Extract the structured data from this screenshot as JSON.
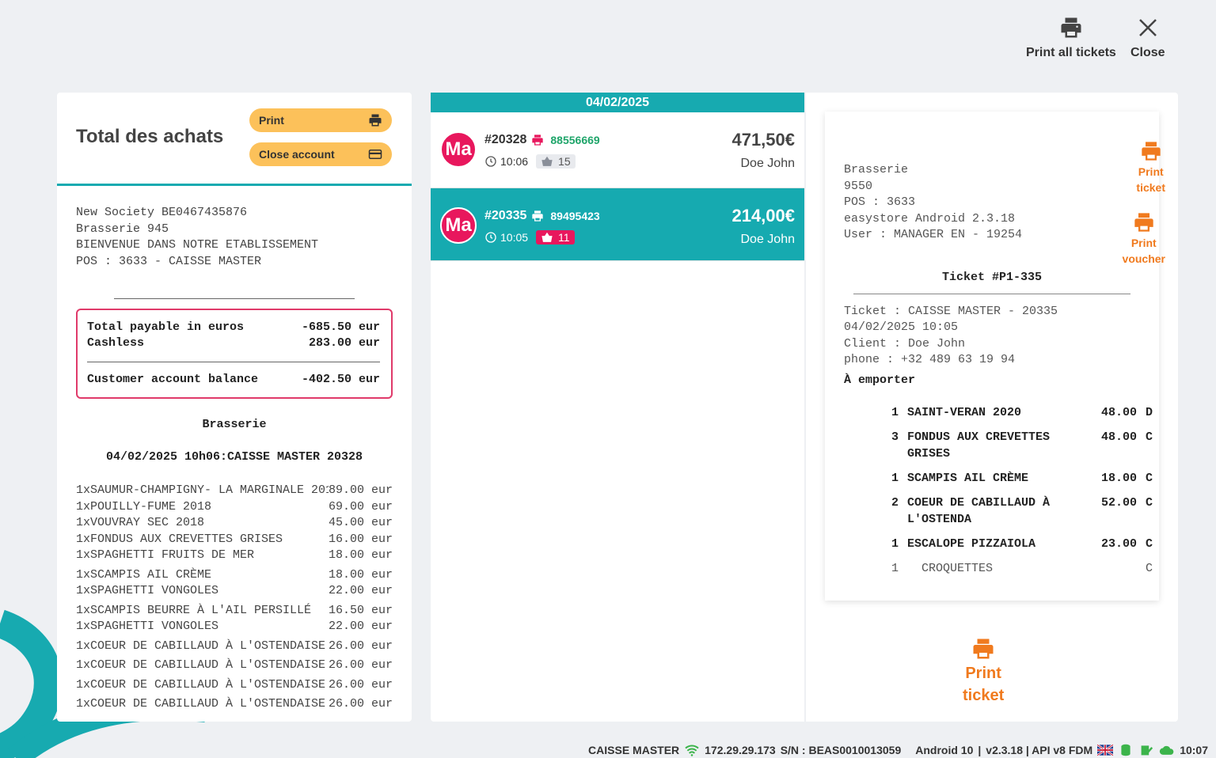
{
  "top_actions": {
    "print_all": "Print all tickets",
    "close": "Close"
  },
  "left": {
    "title": "Total des achats",
    "print_btn": "Print",
    "close_account_btn": "Close account",
    "society": [
      "New Society BE0467435876",
      "Brasserie 945",
      "BIENVENUE DANS NOTRE ETABLISSEMENT",
      "POS : 3633 - CAISSE MASTER"
    ],
    "totals": {
      "payable_label": "Total payable in euros",
      "payable_value": "-685.50 eur",
      "cashless_label": "Cashless",
      "cashless_value": "283.00 eur",
      "balance_label": "Customer account balance",
      "balance_value": "-402.50 eur"
    },
    "venue": "Brasserie",
    "header_line": "04/02/2025 10h06:CAISSE MASTER 20328",
    "items": [
      {
        "name": "1xSAUMUR-CHAMPIGNY- LA MARGINALE 2019",
        "price": "89.00 eur"
      },
      {
        "name": "1xPOUILLY-FUME 2018",
        "price": "69.00 eur"
      },
      {
        "name": "1xVOUVRAY SEC 2018",
        "price": "45.00 eur"
      },
      {
        "name": "1xFONDUS AUX CREVETTES GRISES",
        "price": "16.00 eur"
      },
      {
        "name": "1xSPAGHETTI FRUITS DE MER",
        "price": "18.00 eur"
      },
      {
        "name": "1xSCAMPIS AIL CRÈME",
        "price": "18.00 eur"
      },
      {
        "name": "1xSPAGHETTI VONGOLES",
        "price": "22.00 eur"
      },
      {
        "name": "1xSCAMPIS BEURRE À L'AIL PERSILLÉ",
        "price": "16.50 eur"
      },
      {
        "name": "1xSPAGHETTI VONGOLES",
        "price": "22.00 eur"
      },
      {
        "name": "1xCOEUR DE CABILLAUD À L'OSTENDAISE",
        "price": "26.00 eur"
      },
      {
        "name": "1xCOEUR DE CABILLAUD À L'OSTENDAISE",
        "price": "26.00 eur"
      },
      {
        "name": "1xCOEUR DE CABILLAUD À L'OSTENDAISE",
        "price": "26.00 eur"
      },
      {
        "name": "1xCOEUR DE CABILLAUD À L'OSTENDAISE",
        "price": "26.00 eur"
      }
    ]
  },
  "middle": {
    "date": "04/02/2025",
    "tickets": [
      {
        "initials": "Ma",
        "number": "#20328",
        "code": "88556669",
        "time": "10:06",
        "count": "15",
        "amount": "471,50€",
        "customer": "Doe John"
      },
      {
        "initials": "Ma",
        "number": "#20335",
        "code": "89495423",
        "time": "10:05",
        "count": "11",
        "amount": "214,00€",
        "customer": "Doe John"
      }
    ]
  },
  "right": {
    "print_ticket": [
      "Print",
      "ticket"
    ],
    "print_voucher": [
      "Print",
      "voucher"
    ],
    "receipt_header": [
      "Brasserie",
      "9550",
      "POS : 3633",
      "easystore Android 2.3.18",
      "User : MANAGER EN - 19254"
    ],
    "receipt_title": "Ticket #P1-335",
    "receipt_info": [
      "Ticket : CAISSE MASTER - 20335",
      "04/02/2025 10:05",
      "Client : Doe John",
      "phone : +32 489 63 19 94"
    ],
    "takeaway": "À emporter",
    "items": [
      {
        "qty": "1",
        "name": "SAINT-VERAN  2020",
        "price": "48.00",
        "code": "D"
      },
      {
        "qty": "3",
        "name": "FONDUS AUX CREVETTES GRISES",
        "price": "48.00",
        "code": "C"
      },
      {
        "qty": "1",
        "name": "SCAMPIS AIL CRÈME",
        "price": "18.00",
        "code": "C"
      },
      {
        "qty": "2",
        "name": "COEUR DE CABILLAUD À L'OSTENDA",
        "price": "52.00",
        "code": "C"
      },
      {
        "qty": "1",
        "name": "ESCALOPE PIZZAIOLA",
        "price": "23.00",
        "code": "C"
      },
      {
        "qty": "1",
        "name": "  CROQUETTES",
        "price": "",
        "code": "C"
      }
    ],
    "bottom_print": [
      "Print",
      "ticket"
    ]
  },
  "status_bar": {
    "station": "CAISSE MASTER",
    "ip": "172.29.29.173",
    "serial": "S/N : BEAS0010013059",
    "os": "Android 10",
    "version": "v2.3.18 | API v8 FDM",
    "time": "10:07"
  },
  "colors": {
    "teal": "#17aab0",
    "magenta": "#e8175d",
    "orange": "#f07a1e",
    "yellow": "#fcc15a"
  }
}
